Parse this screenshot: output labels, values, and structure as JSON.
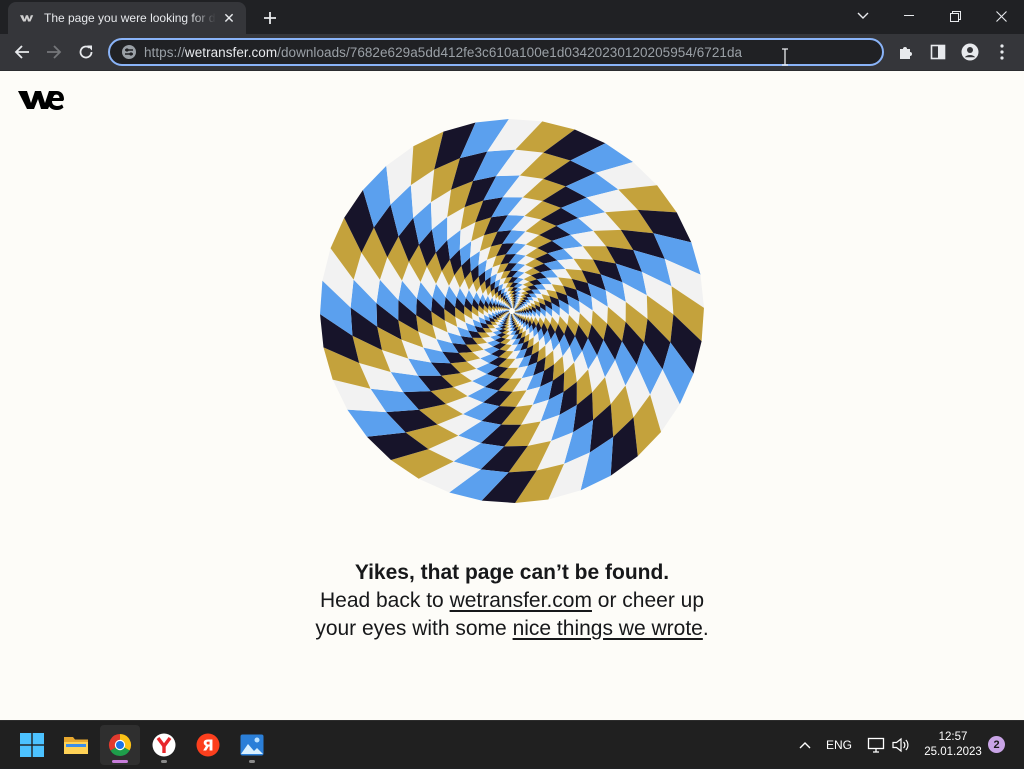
{
  "browser": {
    "tab": {
      "title": "The page you were looking for doesn't exist",
      "favicon": "wetransfer-icon",
      "close_glyph": "✕"
    },
    "new_tab": "plus-icon",
    "window_controls": [
      "chevron-down-icon",
      "minimize-icon",
      "restore-icon",
      "close-icon"
    ],
    "toolbar": {
      "back": "back-arrow-icon",
      "forward": "forward-arrow-icon",
      "reload": "reload-icon",
      "extensions": "puzzle-icon",
      "side_panel": "side-panel-icon",
      "profile": "profile-icon",
      "menu": "more-vert-icon"
    },
    "omnibox": {
      "scheme": "https://",
      "host": "wetransfer.com",
      "path": "/downloads/7682e629a5dd412fe3c610a100e1d03420230120205954/6721da",
      "site_info_icon": "tune-icon"
    }
  },
  "page": {
    "logo": "we",
    "illustration": "spiral-checker-illusion",
    "colors": {
      "background": "#fdfcf8",
      "gold": "#c4a23c",
      "navy": "#17142a",
      "blue": "#5ba0ee",
      "white": "#f2f2f2"
    },
    "message": {
      "title": "Yikes, that page can’t be found.",
      "line_prefix": "Head back to",
      "link_home": "wetransfer.com",
      "line_middle": "or cheer up your eyes with some",
      "link_stories": "nice things we wrote",
      "line_suffix": "."
    }
  },
  "taskbar": {
    "apps": [
      {
        "name": "start",
        "icon": "windows-logo-icon",
        "running": false,
        "active": false
      },
      {
        "name": "file-explorer",
        "icon": "folder-icon",
        "running": false,
        "active": false
      },
      {
        "name": "chrome",
        "icon": "chrome-icon",
        "running": true,
        "active": true
      },
      {
        "name": "yandex-browser",
        "icon": "yandex-browser-icon",
        "running": true,
        "active": false
      },
      {
        "name": "yandex",
        "icon": "yandex-icon",
        "running": false,
        "active": false
      },
      {
        "name": "photos",
        "icon": "photos-icon",
        "running": true,
        "active": false
      }
    ],
    "tray": {
      "overflow": "chevron-up-icon",
      "language": "ENG",
      "network": "network-icon",
      "volume": "volume-icon",
      "time": "12:57",
      "date": "25.01.2023",
      "notifications": "2"
    }
  }
}
